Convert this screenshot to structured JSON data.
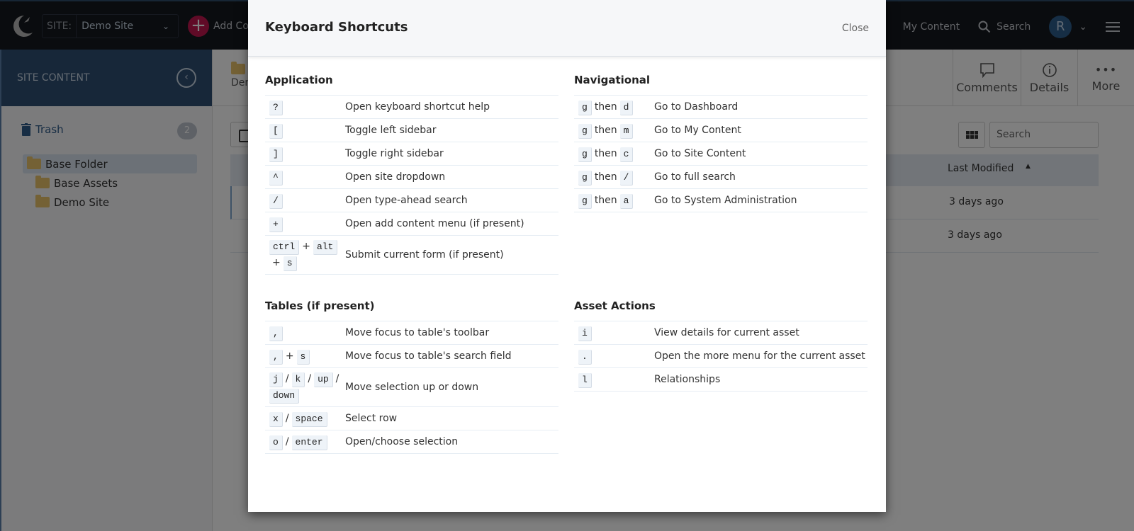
{
  "topbar": {
    "site_label": "SITE:",
    "site_value": "Demo Site",
    "add_content_label": "Add Content",
    "my_content_label": "My Content",
    "search_label": "Search",
    "avatar_initial": "R"
  },
  "sidebar": {
    "title": "SITE CONTENT",
    "trash_label": "Trash",
    "trash_count": "2",
    "tree": [
      {
        "label": "Base Folder",
        "selected": true
      },
      {
        "label": "Base Assets"
      },
      {
        "label": "Demo Site"
      }
    ]
  },
  "main": {
    "breadcrumb_label": "Demo Site",
    "tools": {
      "comments": "Comments",
      "details": "Details",
      "more": "More"
    },
    "search_placeholder": "Search",
    "table": {
      "headers": {
        "last_modified": "Last Modified"
      },
      "rows": [
        {
          "last_modified": "3 days ago"
        },
        {
          "last_modified": "3 days ago"
        }
      ]
    }
  },
  "modal": {
    "title": "Keyboard Shortcuts",
    "close_label": "Close",
    "sections": {
      "application": {
        "title": "Application",
        "rows": [
          {
            "keys": "?",
            "desc": "Open keyboard shortcut help"
          },
          {
            "keys": "[",
            "desc": "Toggle left sidebar"
          },
          {
            "keys": "]",
            "desc": "Toggle right sidebar"
          },
          {
            "keys": "^",
            "desc": "Open site dropdown"
          },
          {
            "keys": "/",
            "desc": "Open type-ahead search"
          },
          {
            "keys": "+",
            "desc": "Open add content menu (if present)"
          },
          {
            "keys": "ctrl + alt + s",
            "desc": "Submit current form (if present)"
          }
        ]
      },
      "navigational": {
        "title": "Navigational",
        "then_word": "then",
        "rows": [
          {
            "keys": "g then d",
            "desc": "Go to Dashboard"
          },
          {
            "keys": "g then m",
            "desc": "Go to My Content"
          },
          {
            "keys": "g then c",
            "desc": "Go to Site Content"
          },
          {
            "keys": "g then /",
            "desc": "Go to full search"
          },
          {
            "keys": "g then a",
            "desc": "Go to System Administration"
          }
        ]
      },
      "tables": {
        "title": "Tables (if present)",
        "rows": [
          {
            "keys": ",",
            "desc": "Move focus to table's toolbar"
          },
          {
            "keys": ", + s",
            "desc": "Move focus to table's search field"
          },
          {
            "keys": "j / k / up / down",
            "desc": "Move selection up or down"
          },
          {
            "keys": "x / space",
            "desc": "Select row"
          },
          {
            "keys": "o / enter",
            "desc": "Open/choose selection"
          }
        ]
      },
      "asset_actions": {
        "title": "Asset Actions",
        "rows": [
          {
            "keys": "i",
            "desc": "View details for current asset"
          },
          {
            "keys": ".",
            "desc": "Open the more menu for the current asset"
          },
          {
            "keys": "l",
            "desc": "Relationships"
          }
        ]
      }
    }
  }
}
